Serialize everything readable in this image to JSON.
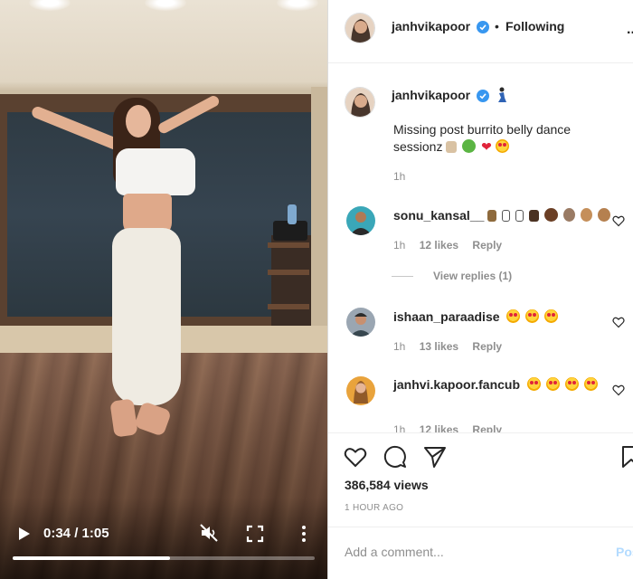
{
  "video": {
    "time_display": "0:34 / 1:05",
    "progress": 0.52
  },
  "header": {
    "username": "janhvikapoor",
    "separator": "•",
    "follow_status": "Following",
    "more_glyph": "..."
  },
  "caption": {
    "username": "janhvikapoor",
    "text": "Missing post burrito belly dance sessionz",
    "time": "1h"
  },
  "comments": [
    {
      "username": "sonu_kansal__",
      "time": "1h",
      "likes": "12 likes",
      "reply_label": "Reply",
      "view_replies": "View replies (1)"
    },
    {
      "username": "ishaan_paraadise",
      "time": "1h",
      "likes": "13 likes",
      "reply_label": "Reply"
    },
    {
      "username": "janhvi.kapoor.fancub",
      "time": "1h",
      "likes": "12 likes",
      "reply_label": "Reply"
    }
  ],
  "actions": {
    "views": "386,584 views",
    "posted_ago": "1 HOUR AGO"
  },
  "add_comment": {
    "placeholder": "Add a comment...",
    "post_label": "Post"
  },
  "colors": {
    "verified_blue": "#3897f0",
    "link_blue": "#b3dbff",
    "meta_gray": "#8e8e8e"
  }
}
